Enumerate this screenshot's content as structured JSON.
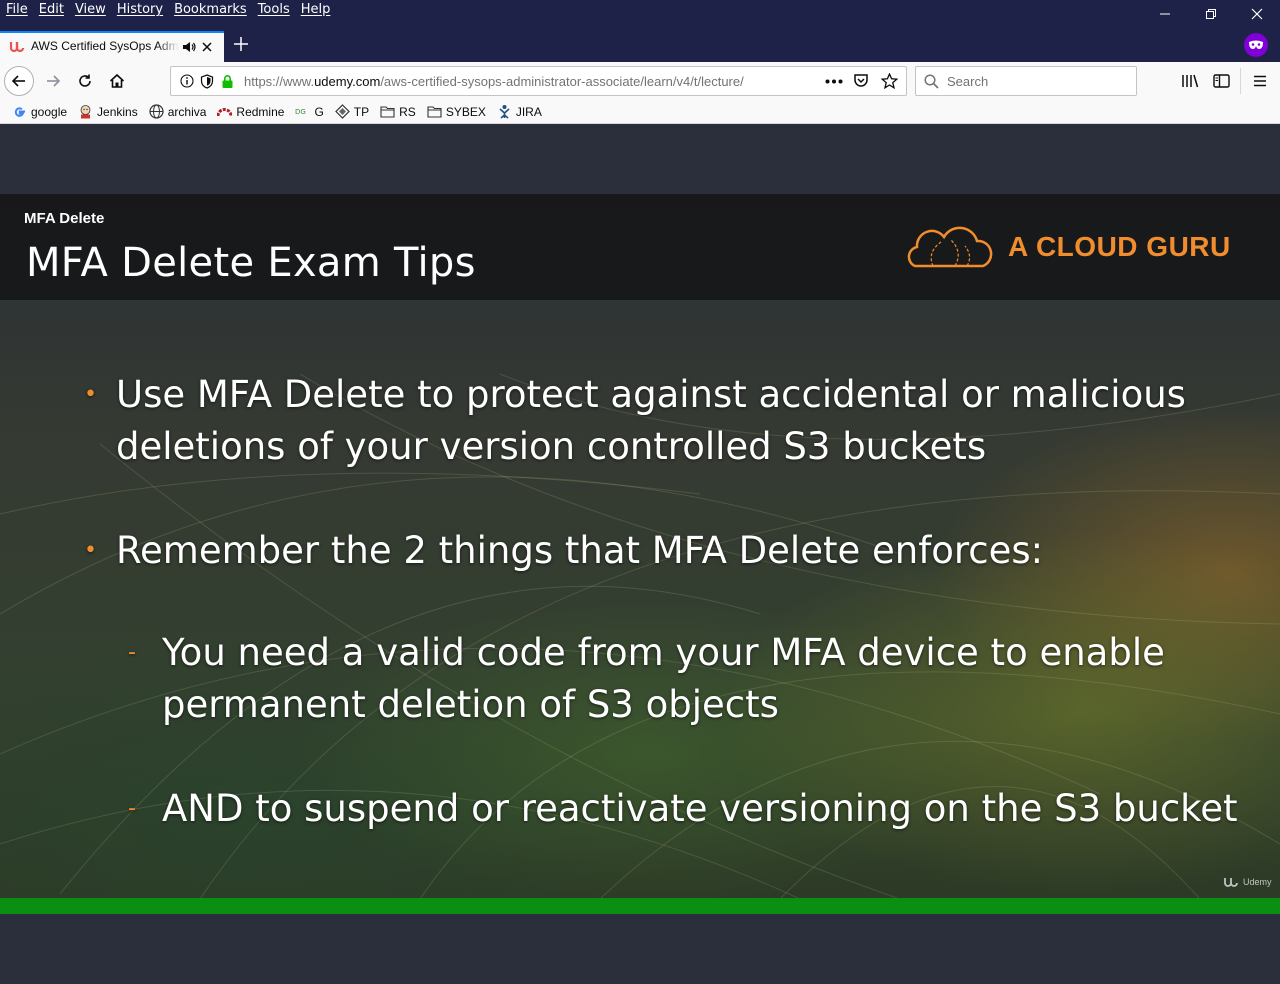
{
  "menubar": {
    "items": [
      "File",
      "Edit",
      "View",
      "History",
      "Bookmarks",
      "Tools",
      "Help"
    ]
  },
  "tab": {
    "title": "AWS Certified SysOps Administrator - Associate",
    "favicon": "udemy-icon"
  },
  "navbar": {
    "url_prefix": "https://www.",
    "url_domain": "udemy.com",
    "url_path": "/aws-certified-sysops-administrator-associate/learn/v4/t/lecture/",
    "search_placeholder": "Search"
  },
  "bookmarks": [
    {
      "label": "google",
      "icon": "google-icon"
    },
    {
      "label": "Jenkins",
      "icon": "jenkins-icon"
    },
    {
      "label": "archiva",
      "icon": "globe-icon"
    },
    {
      "label": "Redmine",
      "icon": "redmine-icon"
    },
    {
      "label": "G",
      "icon": "g-icon"
    },
    {
      "label": "TP",
      "icon": "tp-icon"
    },
    {
      "label": "RS",
      "icon": "folder-icon"
    },
    {
      "label": "SYBEX",
      "icon": "folder-icon"
    },
    {
      "label": "JIRA",
      "icon": "jira-icon"
    }
  ],
  "slide": {
    "kicker": "MFA Delete",
    "title": "MFA Delete Exam Tips",
    "brand": "A CLOUD GURU",
    "bullets": [
      {
        "level": 1,
        "text_line1": "Use MFA Delete to protect against accidental or malicious",
        "text_line2": "deletions of your version controlled S3 buckets"
      },
      {
        "level": 1,
        "text_line1": "Remember the 2 things that MFA Delete enforces:"
      },
      {
        "level": 2,
        "text_line1": "You need a valid code from your MFA device to enable",
        "text_line2": "permanent deletion of S3 objects"
      },
      {
        "level": 2,
        "text_line1": "AND to suspend or reactivate versioning on the S3 bucket"
      }
    ],
    "watermark": "Udemy",
    "bullet_marker": "•",
    "sub_marker": "-"
  },
  "video": {
    "progress": 1.0
  },
  "colors": {
    "accent": "#f18d2c",
    "progress": "#0a8f12",
    "chrome_dark": "#1e2148"
  }
}
